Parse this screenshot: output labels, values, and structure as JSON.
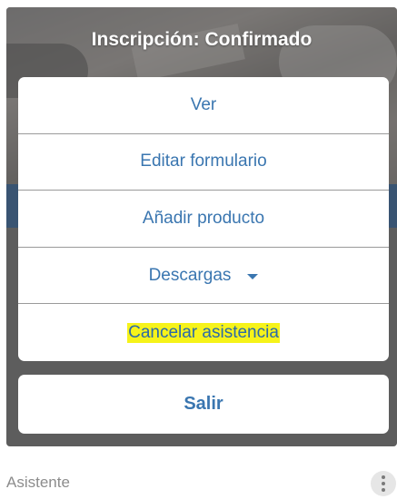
{
  "dialog": {
    "title": "Inscripción: Confirmado",
    "items": [
      {
        "label": "Ver"
      },
      {
        "label": "Editar formulario"
      },
      {
        "label": "Añadir producto"
      },
      {
        "label": "Descargas",
        "icon": "caret-down-icon"
      },
      {
        "label": "Cancelar asistencia",
        "highlighted": true
      }
    ],
    "exit_label": "Salir"
  },
  "footer": {
    "label": "Asistente",
    "more_icon": "more-vertical-icon"
  },
  "colors": {
    "accent": "#3a76b0",
    "highlight": "#f6f31a",
    "band": "#2f5f96"
  }
}
